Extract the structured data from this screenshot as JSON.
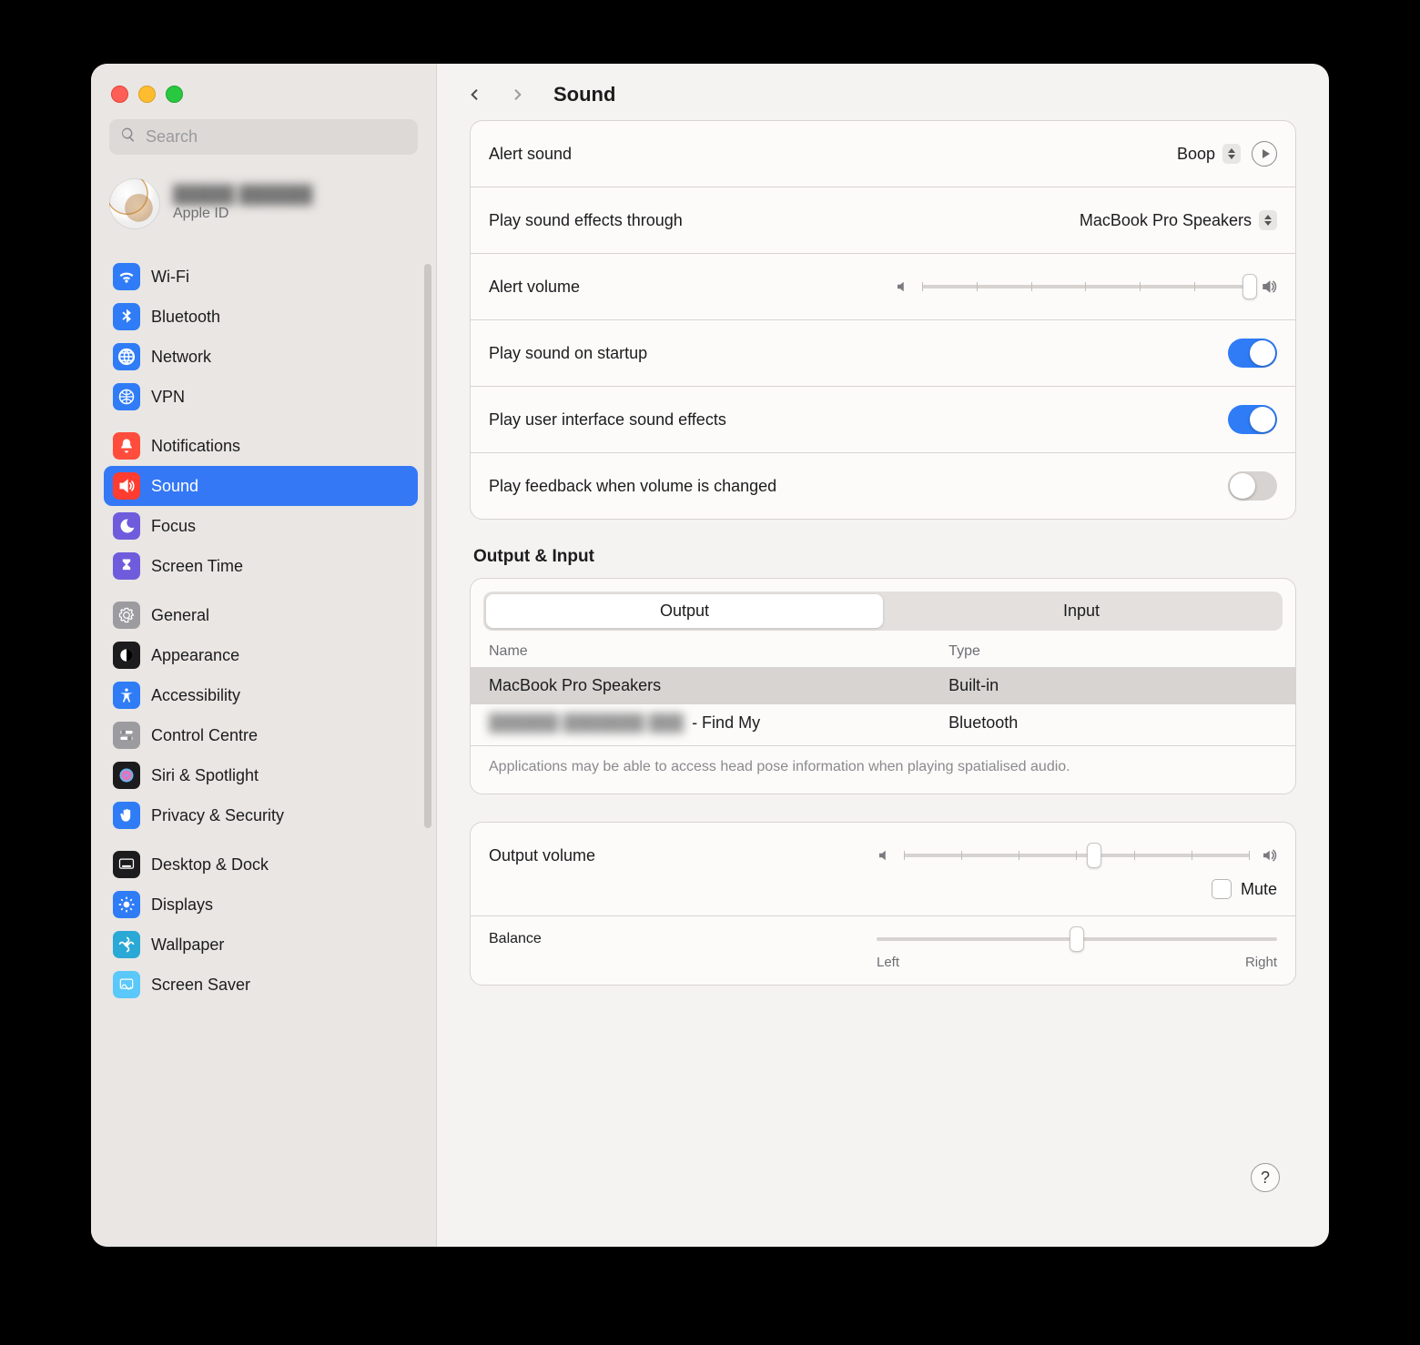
{
  "window": {
    "title": "Sound",
    "search_placeholder": "Search"
  },
  "profile": {
    "name_blurred": "█████ ██████",
    "subtitle": "Apple ID"
  },
  "sidebar_groups": [
    [
      {
        "id": "wifi",
        "label": "Wi-Fi",
        "icon": "wifi",
        "color": "blue"
      },
      {
        "id": "bluetooth",
        "label": "Bluetooth",
        "icon": "bluetooth",
        "color": "blue"
      },
      {
        "id": "network",
        "label": "Network",
        "icon": "globe",
        "color": "blue"
      },
      {
        "id": "vpn",
        "label": "VPN",
        "icon": "vpn",
        "color": "blue"
      }
    ],
    [
      {
        "id": "notifications",
        "label": "Notifications",
        "icon": "bell",
        "color": "red"
      },
      {
        "id": "sound",
        "label": "Sound",
        "icon": "speaker",
        "color": "redS",
        "active": true
      },
      {
        "id": "focus",
        "label": "Focus",
        "icon": "moon",
        "color": "purple"
      },
      {
        "id": "screentime",
        "label": "Screen Time",
        "icon": "hourglass",
        "color": "hour"
      }
    ],
    [
      {
        "id": "general",
        "label": "General",
        "icon": "gear",
        "color": "gray"
      },
      {
        "id": "appearance",
        "label": "Appearance",
        "icon": "appearance",
        "color": "black"
      },
      {
        "id": "accessibility",
        "label": "Accessibility",
        "icon": "access",
        "color": "blue"
      },
      {
        "id": "controlcentre",
        "label": "Control Centre",
        "icon": "toggles",
        "color": "gray"
      },
      {
        "id": "siri",
        "label": "Siri & Spotlight",
        "icon": "siri",
        "color": "black"
      },
      {
        "id": "privacy",
        "label": "Privacy & Security",
        "icon": "hand",
        "color": "blue"
      }
    ],
    [
      {
        "id": "desktop",
        "label": "Desktop & Dock",
        "icon": "dock",
        "color": "black"
      },
      {
        "id": "displays",
        "label": "Displays",
        "icon": "sun",
        "color": "blue"
      },
      {
        "id": "wallpaper",
        "label": "Wallpaper",
        "icon": "flower",
        "color": "teal"
      },
      {
        "id": "screensaver",
        "label": "Screen Saver",
        "icon": "screensaver",
        "color": "cyan"
      }
    ]
  ],
  "sound": {
    "alert_sound_label": "Alert sound",
    "alert_sound_value": "Boop",
    "effects_through_label": "Play sound effects through",
    "effects_through_value": "MacBook Pro Speakers",
    "alert_volume_label": "Alert volume",
    "alert_volume_percent": 100,
    "startup_label": "Play sound on startup",
    "startup_on": true,
    "ui_effects_label": "Play user interface sound effects",
    "ui_effects_on": true,
    "feedback_label": "Play feedback when volume is changed",
    "feedback_on": false
  },
  "io": {
    "section_title": "Output & Input",
    "tabs": [
      "Output",
      "Input"
    ],
    "active_tab": 0,
    "col_name": "Name",
    "col_type": "Type",
    "rows": [
      {
        "name": "MacBook Pro Speakers",
        "type": "Built-in",
        "selected": true
      },
      {
        "name_blurred": "██████ ███████ ███",
        "name_suffix": " - Find My",
        "type": "Bluetooth",
        "selected": false
      }
    ],
    "hint": "Applications may be able to access head pose information when playing spatialised audio.",
    "output_volume_label": "Output volume",
    "output_volume_percent": 55,
    "mute_label": "Mute",
    "mute_checked": false,
    "balance_label": "Balance",
    "balance_percent": 50,
    "balance_left": "Left",
    "balance_right": "Right"
  },
  "help": "?"
}
